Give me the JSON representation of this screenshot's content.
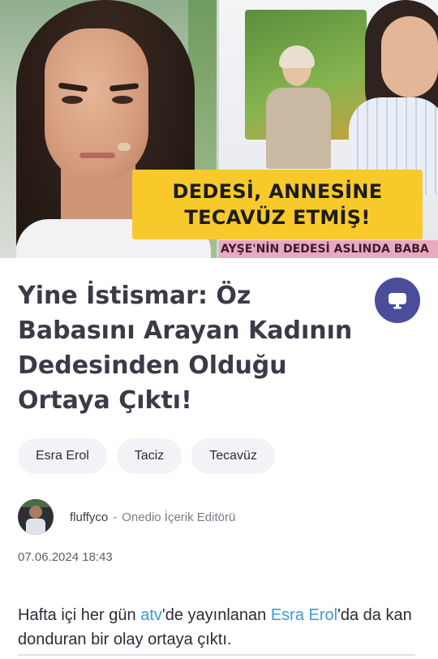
{
  "hero": {
    "overlay_line1": "DEDESİ, ANNESİNE",
    "overlay_line2": "TECAVÜZ ETMİŞ!",
    "ticker": "AYŞE'NİN DEDESİ ASLINDA BABA"
  },
  "article": {
    "title": "Yine İstismar: Öz Babasını Arayan Kadının Dedesinden Olduğu Ortaya Çıktı!",
    "tags": [
      "Esra Erol",
      "Taciz",
      "Tecavüz"
    ],
    "author": {
      "name": "fluffyco",
      "separator": "-",
      "role": "Onedio İçerik Editörü"
    },
    "date": "07.06.2024 18:43",
    "body": {
      "part1": "Hafta içi her gün ",
      "link1": "atv",
      "part2": "'de yayınlanan ",
      "link2": "Esra Erol",
      "part3": "'da da kan donduran bir olay ortaya çıktı."
    }
  },
  "icons": {
    "save_fab": "monitor-icon"
  },
  "colors": {
    "fab": "#4b4c9a",
    "link": "#3b9ad6",
    "overlay": "#f7c92a"
  }
}
